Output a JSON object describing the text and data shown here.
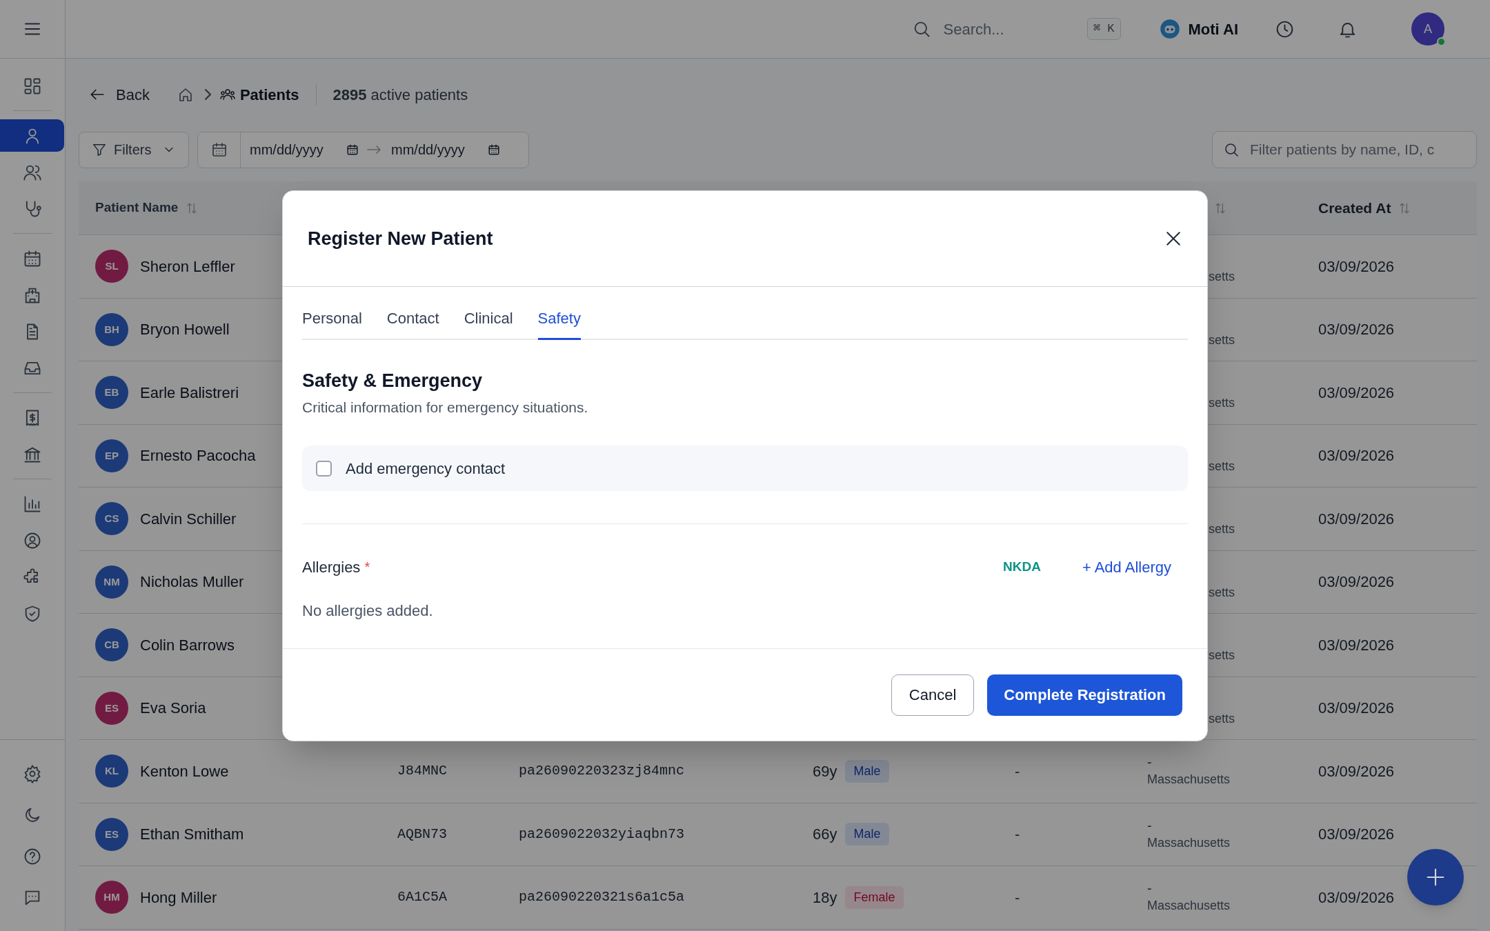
{
  "topbar": {
    "search": {
      "placeholder": "Search..."
    },
    "shortcut": "⌘ K",
    "assistant": "Moti AI",
    "avatar": "A",
    "online": true
  },
  "sidebar": {
    "groups": [
      [
        {
          "selected": false
        }
      ],
      [
        {
          "selected": true
        },
        {
          "selected": false
        },
        {
          "selected": false
        }
      ],
      [
        {
          "selected": false
        },
        {
          "selected": false
        },
        {
          "selected": false
        },
        {
          "selected": false
        }
      ],
      [
        {
          "selected": false
        },
        {
          "selected": false
        }
      ],
      [
        {
          "selected": false
        },
        {
          "selected": false
        },
        {
          "selected": false
        },
        {
          "selected": false
        }
      ]
    ],
    "footer": [
      {
        "selected": false
      },
      {
        "selected": false
      },
      {
        "selected": false
      },
      {
        "selected": false
      }
    ]
  },
  "breadcrumb": {
    "back": "Back",
    "current": "Patients",
    "count": "**2895** active patients"
  },
  "filters": {
    "button": "Filters",
    "date_from": {
      "placeholder": "mm/dd/yyyy"
    },
    "date_to": {
      "placeholder": "mm/dd/yyyy"
    },
    "search": {
      "placeholder": "Filter patients by name, ID, c"
    }
  },
  "table": {
    "columns": [
      {
        "label": "Patient Name"
      },
      {
        "label": "Created At"
      }
    ],
    "rows": [
      {
        "initials": "SL",
        "kind": "female",
        "name": "Sheron Leffler",
        "location": "setts",
        "created": "03/09/2026"
      },
      {
        "initials": "BH",
        "kind": "male",
        "name": "Bryon Howell",
        "location": "setts",
        "created": "03/09/2026"
      },
      {
        "initials": "EB",
        "kind": "male",
        "name": "Earle Balistreri",
        "location": "setts",
        "created": "03/09/2026"
      },
      {
        "initials": "EP",
        "kind": "male",
        "name": "Ernesto Pacocha",
        "location": "setts",
        "created": "03/09/2026"
      },
      {
        "initials": "CS",
        "kind": "male",
        "name": "Calvin Schiller",
        "location": "setts",
        "created": "03/09/2026"
      },
      {
        "initials": "NM",
        "kind": "male",
        "name": "Nicholas Muller",
        "location": "setts",
        "created": "03/09/2026"
      },
      {
        "initials": "CB",
        "kind": "male",
        "name": "Colin Barrows",
        "location": "setts",
        "created": "03/09/2026"
      },
      {
        "initials": "ES",
        "kind": "female",
        "name": "Eva Soria",
        "location": "setts",
        "created": "03/09/2026"
      },
      {
        "initials": "KL",
        "kind": "male",
        "name": "Kenton Lowe",
        "code": "J84MNC",
        "patient_id": "pa26090220323zj84mnc",
        "age": "69y",
        "gender": {
          "text": "Male",
          "kind": "male"
        },
        "column_5": "-",
        "location_line": "-",
        "location": "Massachusetts",
        "created": "03/09/2026"
      },
      {
        "initials": "ES",
        "kind": "male",
        "name": "Ethan Smitham",
        "code": "AQBN73",
        "patient_id": "pa2609022032yiaqbn73",
        "age": "66y",
        "gender": {
          "text": "Male",
          "kind": "male"
        },
        "column_5": "-",
        "location_line": "-",
        "location": "Massachusetts",
        "created": "03/09/2026"
      },
      {
        "initials": "HM",
        "kind": "female",
        "name": "Hong Miller",
        "code": "6A1C5A",
        "patient_id": "pa26090220321s6a1c5a",
        "age": "18y",
        "gender": {
          "text": "Female",
          "kind": "female"
        },
        "column_5": "-",
        "location_line": "-",
        "location": "Massachusetts",
        "created": "03/09/2026"
      }
    ]
  },
  "modal": {
    "title": "Register New Patient",
    "tabs": [
      {
        "label": "Personal",
        "selected": false
      },
      {
        "label": "Contact",
        "selected": false
      },
      {
        "label": "Clinical",
        "selected": false
      },
      {
        "label": "Safety",
        "selected": true
      }
    ],
    "section_title": "Safety & Emergency",
    "section_subtitle": "Critical information for emergency situations.",
    "emergency_contact": {
      "label": "Add emergency contact",
      "checked": false
    },
    "allergies": {
      "label": "Allergies",
      "required_mark": "*",
      "nkda": "NKDA",
      "add": "+ Add Allergy",
      "empty": "No allergies added."
    },
    "buttons": [
      {
        "label": "Cancel",
        "kind": "secondary"
      },
      {
        "label": "Complete Registration",
        "kind": "primary"
      }
    ]
  }
}
